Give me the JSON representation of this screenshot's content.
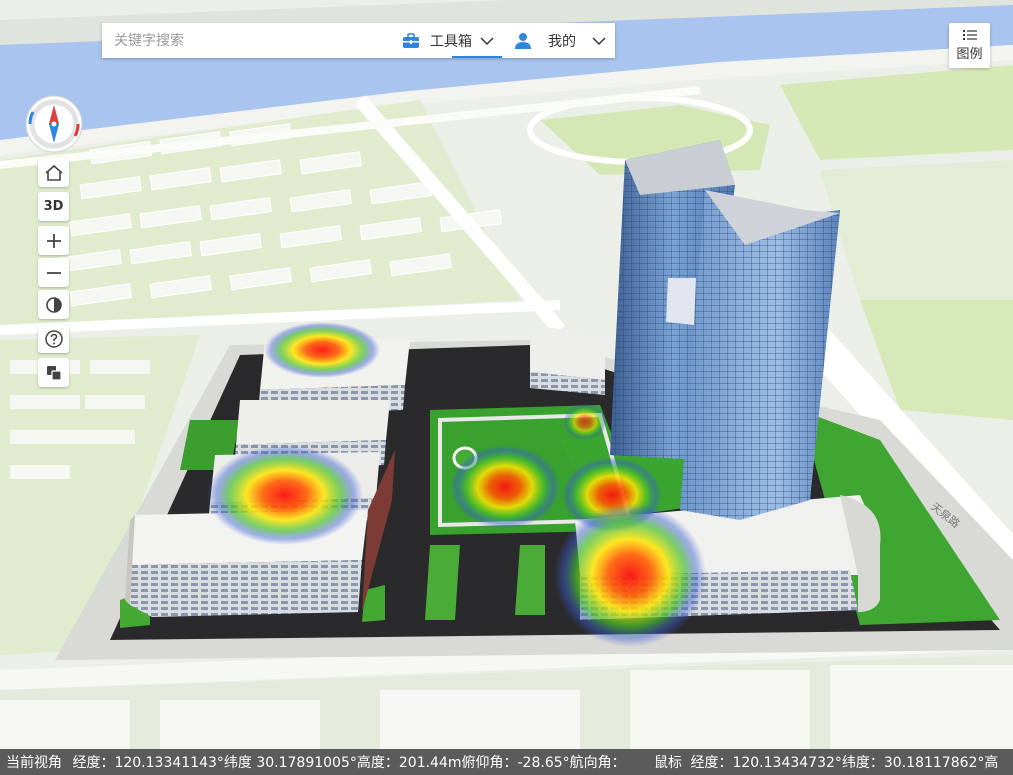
{
  "search": {
    "placeholder": "关键字搜索"
  },
  "toolbar": {
    "toolbox_label": "工具箱",
    "mine_label": "我的"
  },
  "legend": {
    "label": "图例"
  },
  "map_controls": {
    "threed_label": "3D"
  },
  "map_labels": {
    "road_east": "天泉路"
  },
  "status": {
    "view_title": "当前视角",
    "lon_label": "经度：",
    "lon_value": "120.13341143°",
    "lat_label": "纬度",
    "lat_value": "30.17891005°",
    "height_label": "高度：",
    "height_value": "201.44m",
    "pitch_label": "俯仰角：",
    "pitch_value": "-28.65°",
    "heading_label": "航向角：",
    "mouse_title": "鼠标",
    "mouse_lon_label": "经度：",
    "mouse_lon_value": "120.13434732°",
    "mouse_lat_label": "纬度：",
    "mouse_lat_value": "30.18117862°",
    "mouse_height_label": "高"
  },
  "colors": {
    "accent": "#2f86dd",
    "river": "#a9c4ee",
    "green": "#4aa83a",
    "glass": "#5c87bf"
  }
}
